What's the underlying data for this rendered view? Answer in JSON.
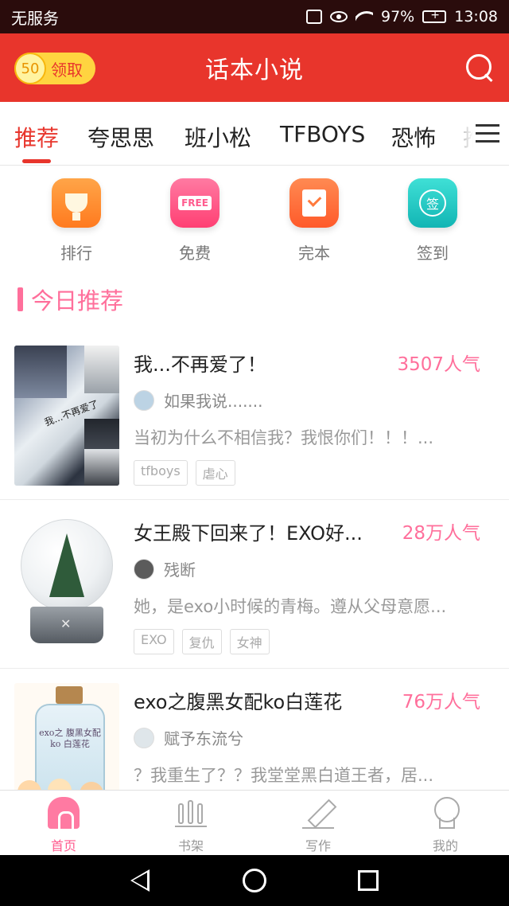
{
  "status_bar": {
    "carrier": "无服务",
    "battery": "97%",
    "time": "13:08"
  },
  "app_bar": {
    "coin_value": "50",
    "coin_label": "领取",
    "title": "话本小说"
  },
  "tabs": [
    {
      "label": "推荐",
      "active": true
    },
    {
      "label": "夸思思",
      "active": false
    },
    {
      "label": "班小松",
      "active": false
    },
    {
      "label": "TFBOYS",
      "active": false
    },
    {
      "label": "恐怖",
      "active": false
    },
    {
      "label": "推",
      "active": false
    }
  ],
  "quick_links": [
    {
      "label": "排行",
      "icon": "trophy-icon",
      "color": "#ff8d2f"
    },
    {
      "label": "免费",
      "icon": "free-icon",
      "color": "#ff4f82",
      "badge": "FREE"
    },
    {
      "label": "完本",
      "icon": "completed-icon",
      "color": "#ff6a38"
    },
    {
      "label": "签到",
      "icon": "checkin-icon",
      "color": "#21c7c0",
      "badge": "签"
    }
  ],
  "section": {
    "title": "今日推荐"
  },
  "books": [
    {
      "title": "我...不再爱了！",
      "popularity": "3507人气",
      "author": "如果我说.......",
      "desc": "当初为什么不相信我？我恨你们！！！...",
      "tags": [
        "tfboys",
        "虐心"
      ],
      "cover_text": "我...不再爱了"
    },
    {
      "title": "女王殿下回来了！EXO好...",
      "popularity": "28万人气",
      "author": "残断",
      "desc": "她，是exo小时候的青梅。遵从父母意愿...",
      "tags": [
        "EXO",
        "复仇",
        "女神"
      ],
      "cover_text": ""
    },
    {
      "title": "exo之腹黑女配ko白莲花",
      "popularity": "76万人气",
      "author": "赋予东流兮",
      "desc": "？我重生了？？我堂堂黑白道王者，居...",
      "tags": [],
      "cover_text": "exo之 腹黑女配ko 白莲花"
    }
  ],
  "bottom_nav": [
    {
      "label": "首页",
      "active": true
    },
    {
      "label": "书架",
      "active": false
    },
    {
      "label": "写作",
      "active": false
    },
    {
      "label": "我的",
      "active": false
    }
  ]
}
